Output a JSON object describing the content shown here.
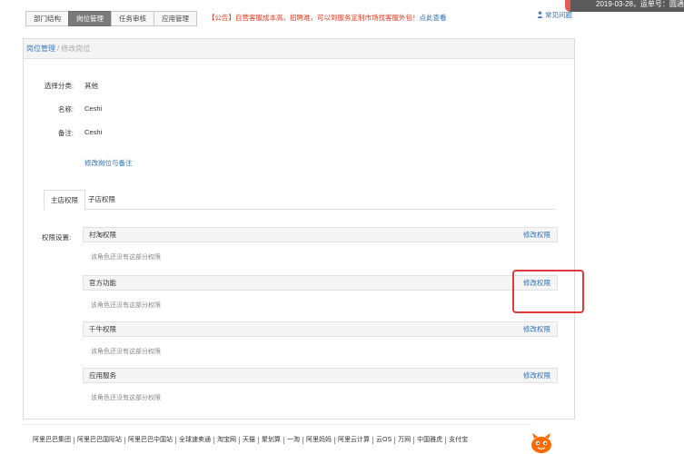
{
  "topbar": {
    "notification_text": "2019-03-28，运单号：圆通"
  },
  "nav": {
    "tabs": [
      {
        "label": "部门结构",
        "active": false
      },
      {
        "label": "岗位管理",
        "active": true
      },
      {
        "label": "任务审核",
        "active": false
      },
      {
        "label": "应用管理",
        "active": false
      }
    ],
    "announcement": "【公告】自营客服成本高，招聘难，可以到服务定制市场找客服外包！",
    "announcement_link": "点此查看",
    "help": "常见问题"
  },
  "breadcrumb": {
    "main": "岗位管理",
    "separator": "/",
    "sub": "修改岗位"
  },
  "form": {
    "category_label": "选择分类:",
    "category_value": "其他",
    "name_label": "名称:",
    "name_value": "Ceshi",
    "remark_label": "备注:",
    "remark_value": "Ceshi",
    "edit_link": "修改岗位与备注"
  },
  "sub_tabs": [
    {
      "label": "主店权限",
      "active": true
    },
    {
      "label": "子店权限",
      "active": false
    }
  ],
  "permissions": {
    "label": "权限设置:",
    "groups": [
      {
        "title": "村淘权限",
        "edit": "修改权限",
        "empty": "该角色还没有这部分权限"
      },
      {
        "title": "官方功能",
        "edit": "修改权限",
        "empty": "该角色还没有这部分权限"
      },
      {
        "title": "千牛权限",
        "edit": "修改权限",
        "empty": "该角色还没有这部分权限"
      },
      {
        "title": "应用服务",
        "edit": "修改权限",
        "empty": "该角色还没有这部分权限"
      }
    ]
  },
  "footer": {
    "links": [
      "阿里巴巴集团",
      "阿里巴巴国际站",
      "阿里巴巴中国站",
      "全球速卖通",
      "淘宝网",
      "天猫",
      "聚划算",
      "一淘",
      "阿里妈妈",
      "阿里云计算",
      "云OS",
      "万网",
      "中国雅虎",
      "支付宝"
    ]
  },
  "colors": {
    "accent": "#2a6fb8",
    "announcement": "#e3371e",
    "active_tab": "#7a7a7a",
    "highlight": "#e0393e"
  }
}
